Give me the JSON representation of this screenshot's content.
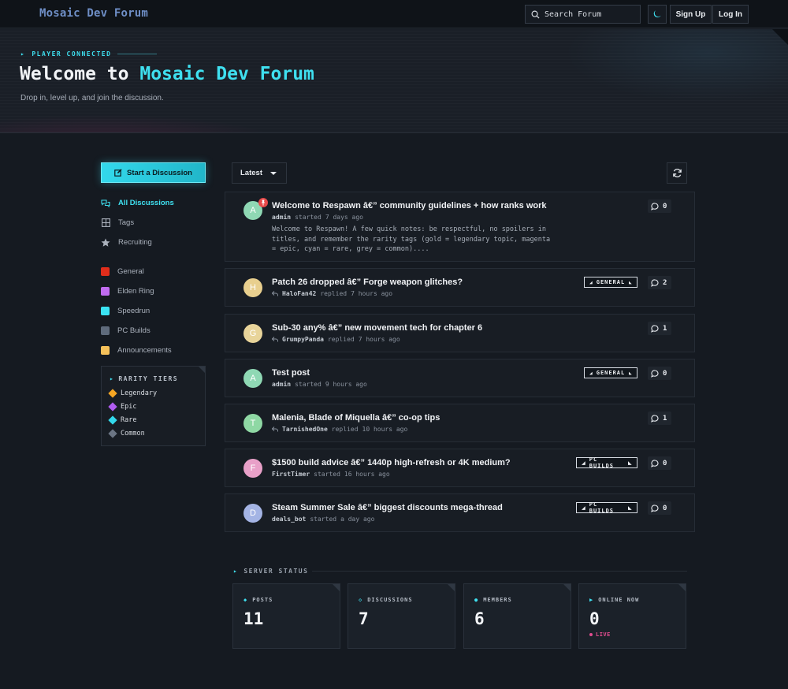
{
  "header": {
    "brand": "Mosaic Dev Forum",
    "search_placeholder": "Search Forum",
    "sign_up": "Sign Up",
    "log_in": "Log In"
  },
  "hero": {
    "kicker": "PLAYER CONNECTED",
    "title_prefix": "Welcome to",
    "title_accent": "Mosaic Dev Forum",
    "subtitle": "Drop in, level up, and join the discussion."
  },
  "sidebar": {
    "start_button": "Start a Discussion",
    "nav": [
      {
        "label": "All Discussions",
        "icon": "discussions-icon",
        "active": true
      },
      {
        "label": "Tags",
        "icon": "tags-icon",
        "active": false
      },
      {
        "label": "Recruiting",
        "icon": "star-icon",
        "active": false
      }
    ],
    "tags": [
      {
        "label": "General",
        "color": "#e02d1b"
      },
      {
        "label": "Elden Ring",
        "color": "#c06cf0"
      },
      {
        "label": "Speedrun",
        "color": "#3ae3f3"
      },
      {
        "label": "PC Builds",
        "color": "#5f6b7c"
      },
      {
        "label": "Announcements",
        "color": "#f5c15a"
      }
    ],
    "rarity": {
      "title": "RARITY TIERS",
      "tiers": [
        {
          "label": "Legendary",
          "color": "#f5a623"
        },
        {
          "label": "Epic",
          "color": "#b05cf0"
        },
        {
          "label": "Rare",
          "color": "#33d9ec"
        },
        {
          "label": "Common",
          "color": "#6b7584"
        }
      ]
    }
  },
  "toolbar": {
    "sort_label": "Latest"
  },
  "discussions": [
    {
      "avatar": "A",
      "avatar_color": "#8fd8b4",
      "pinned": true,
      "title": "Welcome to Respawn â€” community guidelines + how ranks work",
      "author": "admin",
      "action": "started",
      "time": "7 days ago",
      "reply_icon": false,
      "excerpt": "Welcome to Respawn! A few quick notes: be respectful, no spoilers in titles, and remember the rarity tags (gold = legendary topic, magenta = epic, cyan = rare, grey = common)....",
      "tag": "",
      "replies": "0"
    },
    {
      "avatar": "H",
      "avatar_color": "#e8cf8e",
      "pinned": false,
      "title": "Patch 26 dropped â€” Forge weapon glitches?",
      "author": "HaloFan42",
      "action": "replied",
      "time": "7 hours ago",
      "reply_icon": true,
      "excerpt": "",
      "tag": "GENERAL",
      "replies": "2"
    },
    {
      "avatar": "G",
      "avatar_color": "#e8d49a",
      "pinned": false,
      "title": "Sub-30 any% â€” new movement tech for chapter 6",
      "author": "GrumpyPanda",
      "action": "replied",
      "time": "7 hours ago",
      "reply_icon": true,
      "excerpt": "",
      "tag": "",
      "replies": "1"
    },
    {
      "avatar": "A",
      "avatar_color": "#8fd8b4",
      "pinned": false,
      "title": "Test post",
      "author": "admin",
      "action": "started",
      "time": "9 hours ago",
      "reply_icon": false,
      "excerpt": "",
      "tag": "GENERAL",
      "replies": "0"
    },
    {
      "avatar": "T",
      "avatar_color": "#8fd8a4",
      "pinned": false,
      "title": "Malenia, Blade of Miquella â€” co-op tips",
      "author": "TarnishedOne",
      "action": "replied",
      "time": "10 hours ago",
      "reply_icon": true,
      "excerpt": "",
      "tag": "",
      "replies": "1"
    },
    {
      "avatar": "F",
      "avatar_color": "#e8a0c8",
      "pinned": false,
      "title": "$1500 build advice â€” 1440p high-refresh or 4K medium?",
      "author": "FirstTimer",
      "action": "started",
      "time": "16 hours ago",
      "reply_icon": false,
      "excerpt": "",
      "tag": "PC BUILDS",
      "replies": "0"
    },
    {
      "avatar": "D",
      "avatar_color": "#a4b4e4",
      "pinned": false,
      "title": "Steam Summer Sale â€” biggest discounts mega-thread",
      "author": "deals_bot",
      "action": "started",
      "time": "a day ago",
      "reply_icon": false,
      "excerpt": "",
      "tag": "PC BUILDS",
      "replies": "0"
    }
  ],
  "server_status": {
    "title": "SERVER STATUS",
    "stats": [
      {
        "label": "POSTS",
        "value": "11",
        "marker": "◆"
      },
      {
        "label": "DISCUSSIONS",
        "value": "7",
        "marker": "◇"
      },
      {
        "label": "MEMBERS",
        "value": "6",
        "marker": "●"
      },
      {
        "label": "ONLINE NOW",
        "value": "0",
        "marker": "▶"
      }
    ],
    "live_label": "LIVE"
  }
}
